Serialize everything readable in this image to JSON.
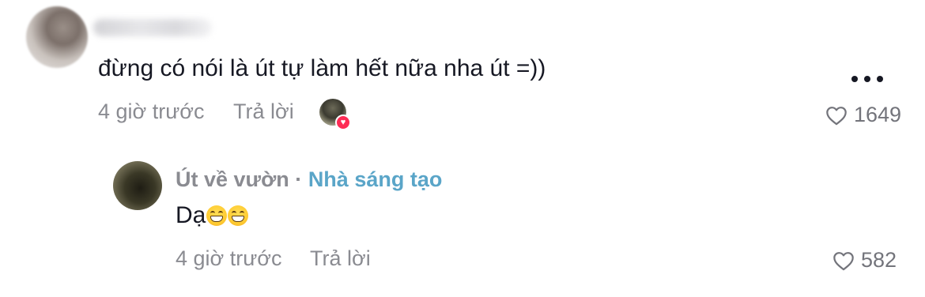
{
  "comment": {
    "username": "",
    "text": "đừng có nói là út tự làm hết nữa nha út =))",
    "time": "4 giờ trước",
    "reply_label": "Trả lời",
    "likes": "1649"
  },
  "reply": {
    "author": "Út về vườn",
    "separator": "·",
    "creator_badge": "Nhà sáng tạo",
    "text": "Dạ",
    "emojis": [
      "grinning-face",
      "grinning-face"
    ],
    "time": "4 giờ trước",
    "reply_label": "Trả lời",
    "likes": "582"
  },
  "icons": {
    "more": "more-horizontal-icon",
    "like": "heart-outline-icon",
    "creator_liked_badge": "heart-filled-icon"
  },
  "colors": {
    "text": "#161823",
    "muted": "#8a8b91",
    "creator_accent": "#5aa5c8",
    "heart_badge": "#fe2c55"
  }
}
